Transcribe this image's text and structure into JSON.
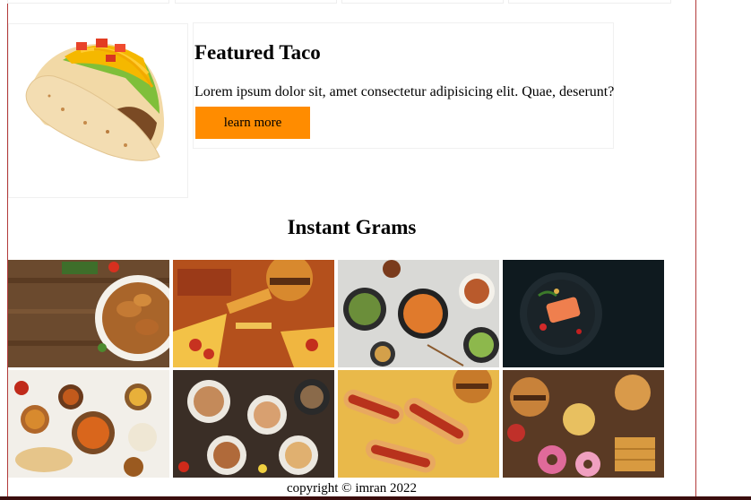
{
  "featured": {
    "title": "Featured Taco",
    "description": "Lorem ipsum dolor sit, amet consectetur adipisicing elit. Quae, deserunt?",
    "button_label": "learn more",
    "accent": "#ff8c00"
  },
  "gallery": {
    "title": "Instant Grams",
    "images": [
      {
        "name": "grilled-chicken-plate",
        "desc": "roast chicken wings on wooden table"
      },
      {
        "name": "fast-food-pile",
        "desc": "pizza burgers fries"
      },
      {
        "name": "asian-dishes-table",
        "desc": "bowls of noodles and salads"
      },
      {
        "name": "salmon-dark-plate",
        "desc": "salmon fillet on black plate"
      },
      {
        "name": "indian-curries",
        "desc": "curries and naan"
      },
      {
        "name": "seafood-spread",
        "desc": "seafood and dishes on dark table"
      },
      {
        "name": "hot-dogs-burgers",
        "desc": "hot dogs burgers and fries"
      },
      {
        "name": "junk-food-assortment",
        "desc": "donuts burgers waffles"
      }
    ]
  },
  "footer": {
    "text": "copyright © imran 2022"
  }
}
